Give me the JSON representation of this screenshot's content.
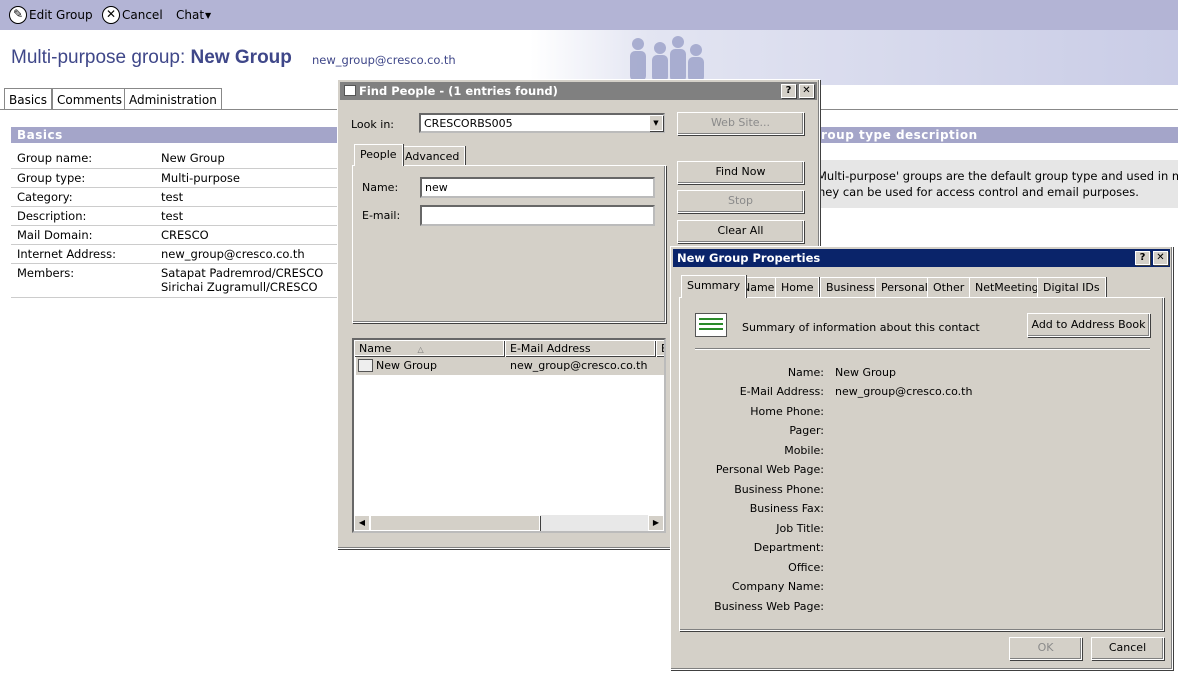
{
  "toolbar": {
    "edit_group": "Edit Group",
    "cancel": "Cancel",
    "chat": "Chat"
  },
  "header": {
    "title_prefix": "Multi-purpose group:",
    "title_name": "New Group",
    "email": "new_group@cresco.co.th"
  },
  "tabs": [
    "Basics",
    "Comments",
    "Administration"
  ],
  "basics": {
    "section_title": "Basics",
    "rows": [
      {
        "label": "Group name:",
        "value": "New Group"
      },
      {
        "label": "Group type:",
        "value": "Multi-purpose"
      },
      {
        "label": "Category:",
        "value": "test"
      },
      {
        "label": "Description:",
        "value": "test"
      },
      {
        "label": "Mail Domain:",
        "value": "CRESCO"
      },
      {
        "label": "Internet Address:",
        "value": "new_group@cresco.co.th"
      },
      {
        "label": "Members:",
        "value": "Satapat Padremrod/CRESCO",
        "value2": "Sirichai Zugramull/CRESCO"
      }
    ]
  },
  "group_type_desc": {
    "section_title": "roup type description",
    "line1": "Multi-purpose' groups are the default group type and used in most s",
    "line2": "hey can be used for access control and email purposes."
  },
  "find_people": {
    "title": "Find People - (1 entries found)",
    "look_in_label": "Look in:",
    "look_in_value": "CRESCORBS005",
    "web_site_btn": "Web Site...",
    "tabs": [
      "People",
      "Advanced"
    ],
    "name_label": "Name:",
    "name_value": "new",
    "email_label": "E-mail:",
    "email_value": "",
    "find_now": "Find Now",
    "stop": "Stop",
    "clear_all": "Clear All",
    "columns": [
      "Name",
      "E-Mail Address",
      "E"
    ],
    "results": [
      {
        "name": "New Group",
        "email": "new_group@cresco.co.th"
      }
    ]
  },
  "props": {
    "title": "New Group Properties",
    "tabs": [
      "Summary",
      "Name",
      "Home",
      "Business",
      "Personal",
      "Other",
      "NetMeeting",
      "Digital IDs"
    ],
    "summary_text": "Summary of information about this contact",
    "add_btn": "Add to Address Book",
    "fields": [
      {
        "label": "Name:",
        "value": "New Group"
      },
      {
        "label": "E-Mail Address:",
        "value": "new_group@cresco.co.th"
      },
      {
        "label": "Home Phone:",
        "value": ""
      },
      {
        "label": "Pager:",
        "value": ""
      },
      {
        "label": "Mobile:",
        "value": ""
      },
      {
        "label": "Personal Web Page:",
        "value": ""
      },
      {
        "label": "Business Phone:",
        "value": ""
      },
      {
        "label": "Business Fax:",
        "value": ""
      },
      {
        "label": "Job Title:",
        "value": ""
      },
      {
        "label": "Department:",
        "value": ""
      },
      {
        "label": "Office:",
        "value": ""
      },
      {
        "label": "Company Name:",
        "value": ""
      },
      {
        "label": "Business Web Page:",
        "value": ""
      }
    ],
    "ok": "OK",
    "cancel": "Cancel"
  },
  "colors": {
    "accent": "#3f4789",
    "toolbar": "#b3b4d5",
    "section": "#a4a5c9",
    "titlebar_active": "#0a246a",
    "titlebar_inactive": "#808080"
  }
}
